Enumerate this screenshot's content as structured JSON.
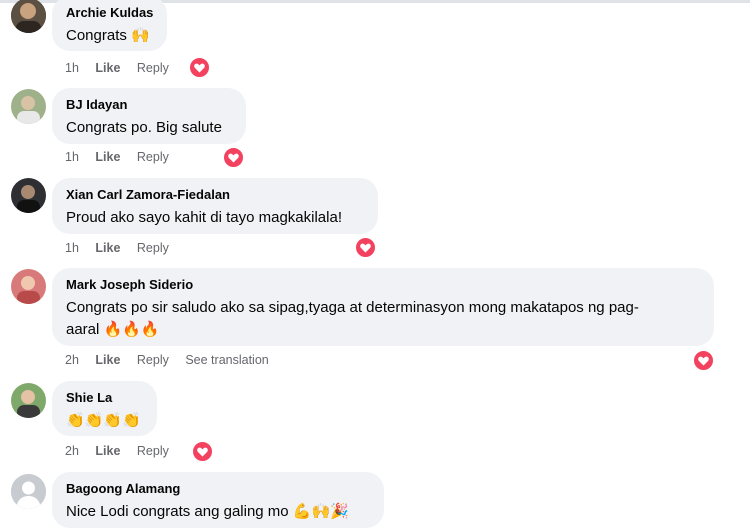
{
  "comments": [
    {
      "author": "Archie Kuldas",
      "text": "Congrats",
      "emoji": "🙌",
      "time": "1h",
      "like": "Like",
      "reply": "Reply"
    },
    {
      "author": "BJ Idayan",
      "text": "Congrats po. Big salute",
      "time": "1h",
      "like": "Like",
      "reply": "Reply"
    },
    {
      "author": "Xian Carl Zamora-Fiedalan",
      "text": "Proud ako sayo kahit di tayo magkakilala!",
      "time": "1h",
      "like": "Like",
      "reply": "Reply"
    },
    {
      "author": "Mark Joseph Siderio",
      "text": "Congrats po sir saludo ako sa sipag,tyaga at determinasyon mong makatapos ng pag-",
      "text2": "aaral",
      "emoji": "🔥🔥🔥",
      "time": "2h",
      "like": "Like",
      "reply": "Reply",
      "see_translation": "See translation"
    },
    {
      "author": "Shie La",
      "emoji": "👏👏👏👏",
      "time": "2h",
      "like": "Like",
      "reply": "Reply"
    },
    {
      "author": "Bagoong Alamang",
      "text": "Nice Lodi congrats ang galing mo",
      "emoji": "💪🙌🎉"
    }
  ],
  "reaction_icon": "heart-icon",
  "colors": {
    "bubble": "#f0f2f5",
    "heart": "#f3425f",
    "meta": "#65676b",
    "text": "#050505"
  }
}
